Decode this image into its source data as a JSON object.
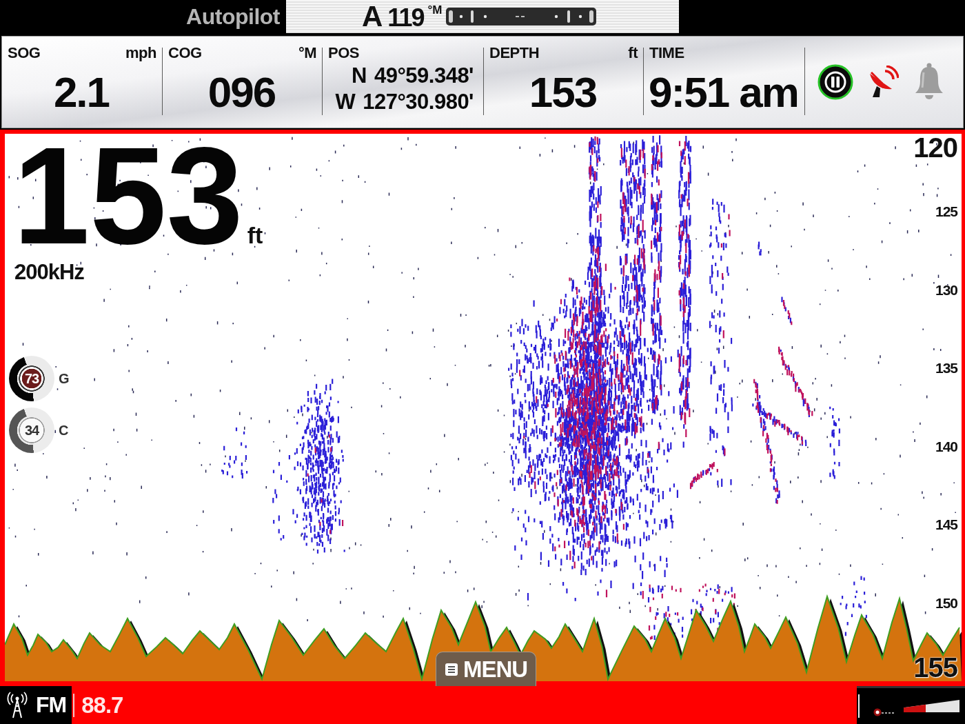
{
  "autopilot": {
    "label": "Autopilot",
    "mode": "A",
    "heading": "119",
    "heading_unit": "°M"
  },
  "instruments": [
    {
      "kind": "value",
      "label": "SOG",
      "unit": "mph",
      "value": "2.1"
    },
    {
      "kind": "value",
      "label": "COG",
      "unit": "°M",
      "value": "096"
    },
    {
      "kind": "position",
      "label": "POS",
      "lines": [
        {
          "hemisphere": "N",
          "value": "49°59.348'"
        },
        {
          "hemisphere": "W",
          "value": "127°30.980'"
        }
      ]
    },
    {
      "kind": "value",
      "label": "DEPTH",
      "unit": "ft",
      "value": "153"
    },
    {
      "kind": "value",
      "label": "TIME",
      "value": "9:51 am"
    }
  ],
  "sonar": {
    "depth": "153",
    "depth_unit": "ft",
    "frequency": "200kHz",
    "gauges": [
      {
        "value": "73",
        "label": "G",
        "selected": true
      },
      {
        "value": "34",
        "label": "C",
        "selected": false
      }
    ],
    "depth_scale": [
      "120",
      "125",
      "130",
      "135",
      "140",
      "145",
      "150",
      "155"
    ]
  },
  "menu_button": {
    "label": "MENU"
  },
  "radio": {
    "band": "FM",
    "frequency": "88.7"
  },
  "volume": {
    "level": 0.4
  }
}
